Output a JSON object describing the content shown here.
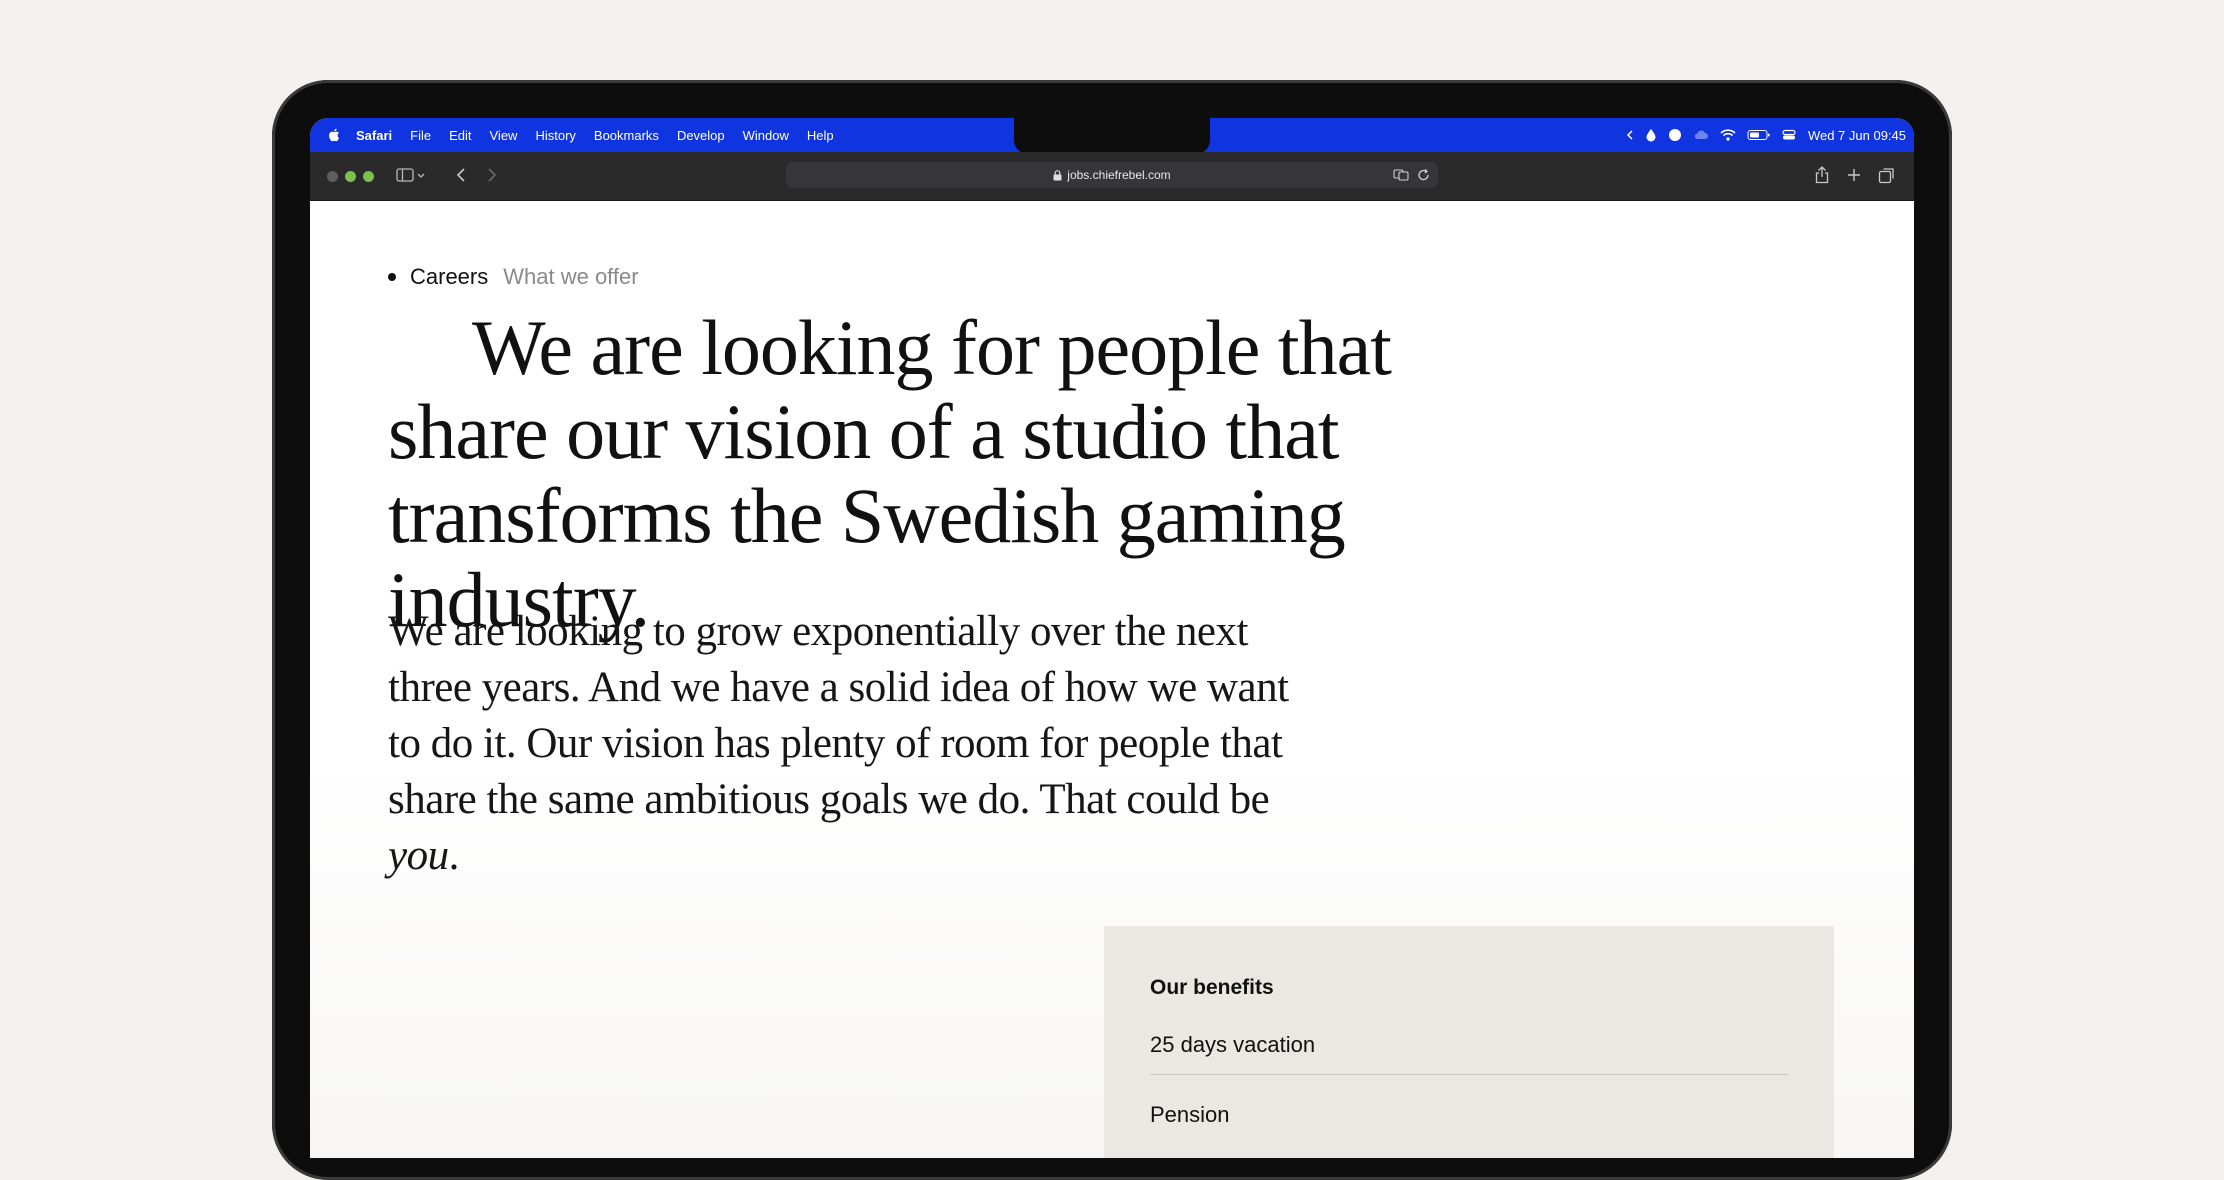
{
  "menubar": {
    "app": "Safari",
    "menus": [
      "File",
      "Edit",
      "View",
      "History",
      "Bookmarks",
      "Develop",
      "Window",
      "Help"
    ],
    "clock": "Wed 7 Jun  09:45"
  },
  "browser": {
    "url": "jobs.chiefrebel.com"
  },
  "page": {
    "breadcrumb": [
      "Careers",
      "What we offer"
    ],
    "headline": "We are looking for people that share our vision of a studio that transforms the Swedish gaming industry.",
    "intro_main": "We are looking to grow exponentially over the next three years. And we have a solid idea of how we want to do it. Our vision has plenty of room for people that share the same ambitious goals we do. That could be ",
    "intro_emphasis": "you",
    "intro_end": ".",
    "benefits": {
      "title": "Our benefits",
      "items": [
        "25 days vacation",
        "Pension"
      ]
    }
  },
  "colors": {
    "menubar": "#1034e0",
    "toolbar": "#2a2a2b",
    "page_bg": "#f3f1ee",
    "benefits_bg": "#ebe8e3"
  }
}
